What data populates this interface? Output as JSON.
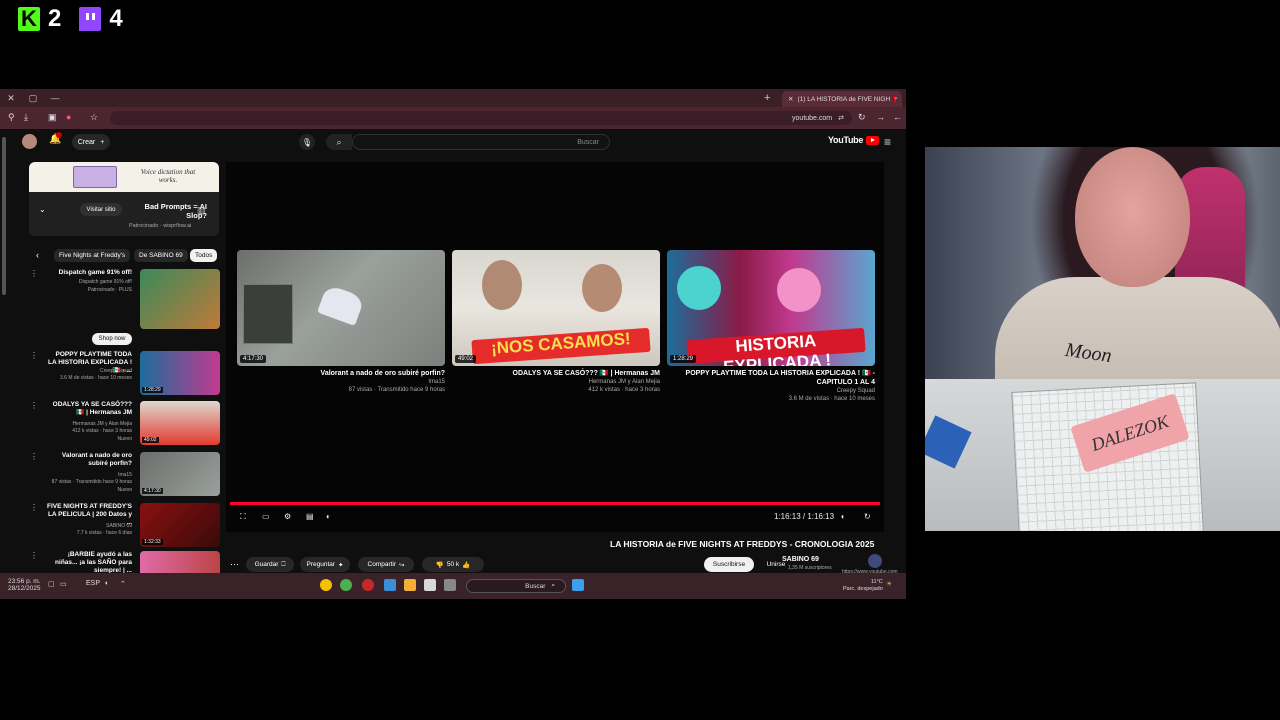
{
  "overlay": {
    "kick_count": "2",
    "twitch_count": "4"
  },
  "browser": {
    "tab_title": "(1) LA HISTORIA de FIVE NIGH",
    "url": "youtube.com"
  },
  "youtube": {
    "logo_text": "YouTube",
    "search_placeholder": "Buscar",
    "create_label": "Crear"
  },
  "player": {
    "time": "1:16:13 / 1:16:13",
    "end_cards": [
      {
        "title": "Valorant a nado de oro subiré porfin?",
        "meta1": "Ima15",
        "meta2": "87 vistas · Transmitido hace 9 horas",
        "duration": "4:17:30"
      },
      {
        "title": "ODALYS YA SE CASÓ??? 🇲🇽 | Hermanas JM",
        "meta1": "Hermanas JM y Alan Mejia",
        "meta2": "412 k vistas · hace 3 horas",
        "duration": "49:02",
        "banner": "¡NOS CASAMOS!"
      },
      {
        "title": "POPPY PLAYTIME TODA LA HISTORIA EXPLICADA ! 🇲🇽 - CAPITULO 1 AL 4",
        "meta1": "Creepy Squad",
        "meta2": "3.6 M de vistas · hace 10 meses",
        "duration": "1:28:29",
        "banner": "HISTORIA EXPLICADA !"
      }
    ]
  },
  "video": {
    "title": "LA HISTORIA de FIVE NIGHTS AT FREDDYS - CRONOLOGIA 2025",
    "channel": "SABINO 69",
    "subscribers": "1,35 M suscriptores",
    "join_label": "Unirse",
    "subscribe_label": "Suscribirse",
    "likes": "50 k",
    "share_label": "Compartir",
    "ask_label": "Preguntar",
    "save_label": "Guardar",
    "url_tip": "https://www.youtube.com"
  },
  "sidebar": {
    "ad": {
      "image_text": "Voice dictation that works.",
      "title": "Bad Prompts = AI Slop?",
      "sponsor": "Patrocinado · wisprflow.ai",
      "visit_label": "Visitar sitio"
    },
    "chips": [
      "Todos",
      "De SABINO 69",
      "Five Nights at Freddy's"
    ],
    "shop_now": "Shop now",
    "recs": [
      {
        "title": "Dispatch game 91% off!",
        "m1": "Dispatch game 91% off!",
        "m2": "Patrocinado · PLUS",
        "duration": ""
      },
      {
        "title": "POPPY PLAYTIME TODA LA HISTORIA EXPLICADA ! 🇲🇽 - ...",
        "m1": "Creepy Squad",
        "m2": "3.6 M de vistas · hace 10 meses",
        "duration": "1:28:29"
      },
      {
        "title": "ODALYS YA SE CASÓ??? 🇲🇽 | Hermanas JM",
        "m1": "Hermanas JM y Alan Mejia",
        "m2": "412 k vistas · hace 3 horas",
        "m3": "Nuevo",
        "duration": "49:02"
      },
      {
        "title": "Valorant a nado de oro subiré porfin?",
        "m1": "Ima15",
        "m2": "87 vistas · Transmitido hace 9 horas",
        "m3": "Nuevo",
        "duration": "4:17:30"
      },
      {
        "title": "FIVE NIGHTS AT FREDDY'S LA PELICULA | 200 Datos y ...",
        "m1": "SABINO 69",
        "m2": "7.7 k vistas · hace 6 días",
        "duration": "1:32:33"
      },
      {
        "title": "¡BARBIE ayudó a las niñas... ¡a las SAÑO para siempre! | ...",
        "m1": "",
        "m2": "",
        "duration": ""
      }
    ]
  },
  "taskbar": {
    "time": "23:56 p. m.",
    "date": "28/12/2025",
    "lang": "ESP",
    "search": "Buscar",
    "weather_temp": "11°C",
    "weather_desc": "Parc. despejado"
  },
  "webcam": {
    "hoodie_text": "Moon",
    "eraser_text": "DALEZOK"
  },
  "colors": {
    "accent_red": "#ff0033",
    "kick_green": "#53fc18",
    "twitch_purple": "#9146ff",
    "browser_frame": "#4b2631"
  }
}
